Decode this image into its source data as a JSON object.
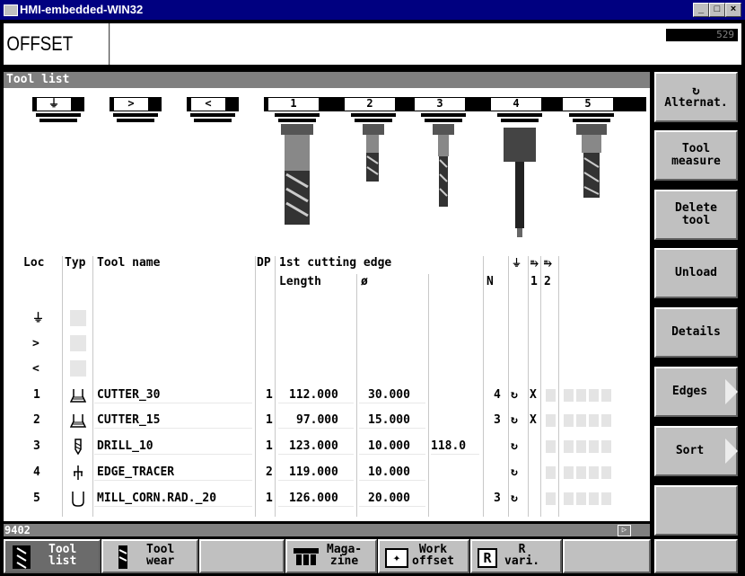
{
  "window": {
    "title": "HMI-embedded-WIN32",
    "minimize": "_",
    "maximize": "□",
    "close": "×"
  },
  "header": {
    "area": "OFFSET",
    "channel_number": "529"
  },
  "panel": {
    "title": "Tool list"
  },
  "magazine": {
    "buffer_slots": [
      "⏚",
      ">",
      "<"
    ],
    "slots": [
      "1",
      "2",
      "3",
      "4",
      "5"
    ]
  },
  "table": {
    "headers": {
      "loc": "Loc",
      "typ": "Typ",
      "name": "Tool name",
      "dp": "DP",
      "edge": "1st cutting edge",
      "length": "Length",
      "diameter": "ø",
      "n": "N",
      "spindle": "⏚",
      "dir1": "⥱",
      "dir2": "⥱",
      "c1": "1",
      "c2": "2"
    },
    "buffer_rows": [
      {
        "loc": "⏚"
      },
      {
        "loc": ">"
      },
      {
        "loc": "<"
      }
    ],
    "rows": [
      {
        "loc": "1",
        "name": "CUTTER_30",
        "dp": "1",
        "length": "112.000",
        "diameter": "30.000",
        "angle": "",
        "n": "4",
        "dir": "↻",
        "mark": "X"
      },
      {
        "loc": "2",
        "name": "CUTTER_15",
        "dp": "1",
        "length": "97.000",
        "diameter": "15.000",
        "angle": "",
        "n": "3",
        "dir": "↻",
        "mark": "X"
      },
      {
        "loc": "3",
        "name": "DRILL_10",
        "dp": "1",
        "length": "123.000",
        "diameter": "10.000",
        "angle": "118.0",
        "n": "",
        "dir": "↻",
        "mark": ""
      },
      {
        "loc": "4",
        "name": "EDGE_TRACER",
        "dp": "2",
        "length": "119.000",
        "diameter": "10.000",
        "angle": "",
        "n": "",
        "dir": "↻",
        "mark": ""
      },
      {
        "loc": "5",
        "name": "MILL_CORN.RAD._20",
        "dp": "1",
        "length": "126.000",
        "diameter": "20.000",
        "angle": "",
        "n": "3",
        "dir": "↻",
        "mark": ""
      }
    ]
  },
  "status": {
    "text": "9402",
    "icon": "arrow-right-icon"
  },
  "right_softkeys": [
    {
      "label": "Alternat.",
      "icon": "cycle-icon"
    },
    {
      "label": "Tool\nmeasure"
    },
    {
      "label": "Delete\ntool"
    },
    {
      "label": "Unload"
    },
    {
      "label": "Details"
    },
    {
      "label": "Edges"
    },
    {
      "label": "Sort"
    },
    {
      "label": ""
    }
  ],
  "bottom_softkeys": [
    {
      "label": "Tool\nlist",
      "icon": "tool-list-icon",
      "active": true
    },
    {
      "label": "Tool\nwear",
      "icon": "tool-wear-icon"
    },
    {
      "label": ""
    },
    {
      "label": "Maga-\nzine",
      "icon": "magazine-icon"
    },
    {
      "label": "Work\noffset",
      "icon": "work-offset-icon"
    },
    {
      "label": "R\nvari.",
      "icon": "r-variables-icon"
    },
    {
      "label": ""
    },
    {
      "label": ""
    }
  ]
}
